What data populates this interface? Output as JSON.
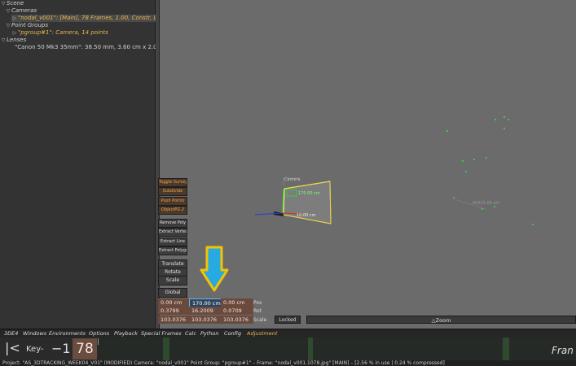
{
  "tree": {
    "scene": "Scene",
    "cameras": "Cameras",
    "camera_item": "\"nodal_v001\": [Main], 78 Frames, 1.00, Constr, Lens -",
    "point_groups": "Point Groups",
    "pgroup_item": "\"pgroup#1\": Camera, 14 points",
    "lenses": "Lenses",
    "lens_item": "\"Canon 50 Mk3 35mm\": 38.50 mm, 3.60 cm x 2.02 cm, \"3"
  },
  "tools": {
    "toggle_survey": "Toggle Survey",
    "subdivide": "Subdivide",
    "push_points": "Push Points",
    "object_pg": "ObjectPG 2",
    "remove_poly": "Remove Poly",
    "extract_vertex": "Extract Vertex",
    "extract_line": "Extract Line",
    "extract_polygon": "Extract Polygon",
    "translate": "Translate",
    "rotate": "Rotate",
    "scale": "Scale",
    "global": "Global"
  },
  "transform": {
    "pos": [
      "0.00 cm",
      "170.00 cm",
      "0.00 cm"
    ],
    "rot": [
      "0.3799",
      "16.2009",
      "0.0709"
    ],
    "scale": [
      "103.0376",
      "103.0376",
      "103.0376"
    ],
    "pos_label": "Pos",
    "rot_label": "Rot",
    "scale_label": "Scale"
  },
  "locked": "Locked",
  "zoom": "△Zoom",
  "viewport": {
    "camera_label": "Camera",
    "dim1": "170.00 cm",
    "dim2": "10.00 cm",
    "dim3": "66325.00 cm"
  },
  "menus": [
    "3DE4",
    "Windows",
    "Environments",
    "Options",
    "Playback",
    "Special Frames",
    "Calc",
    "Python",
    "Config",
    "Adjustment"
  ],
  "timeline": {
    "start": "|<",
    "key": "Key-",
    "minus": "−1",
    "frame": "78",
    "frame_label": "Fran"
  },
  "status": "Project: \"AS_3DTRACKING_WEEK04_V01\" (MODIFIED)  Camera: \"nodal_v001\"  Point Group: \"pgroup#1\"  –  Frame: \"nodal_v001.1078.jpg\"  [MAIN]  –  [2.56 % in use | 0.24 % compressed]",
  "colors": {
    "accent_orange": "#e8b64a",
    "arrow_yellow": "#f5c400",
    "arrow_blue": "#27a9e1",
    "viewport_bg": "#6b6b6b"
  }
}
